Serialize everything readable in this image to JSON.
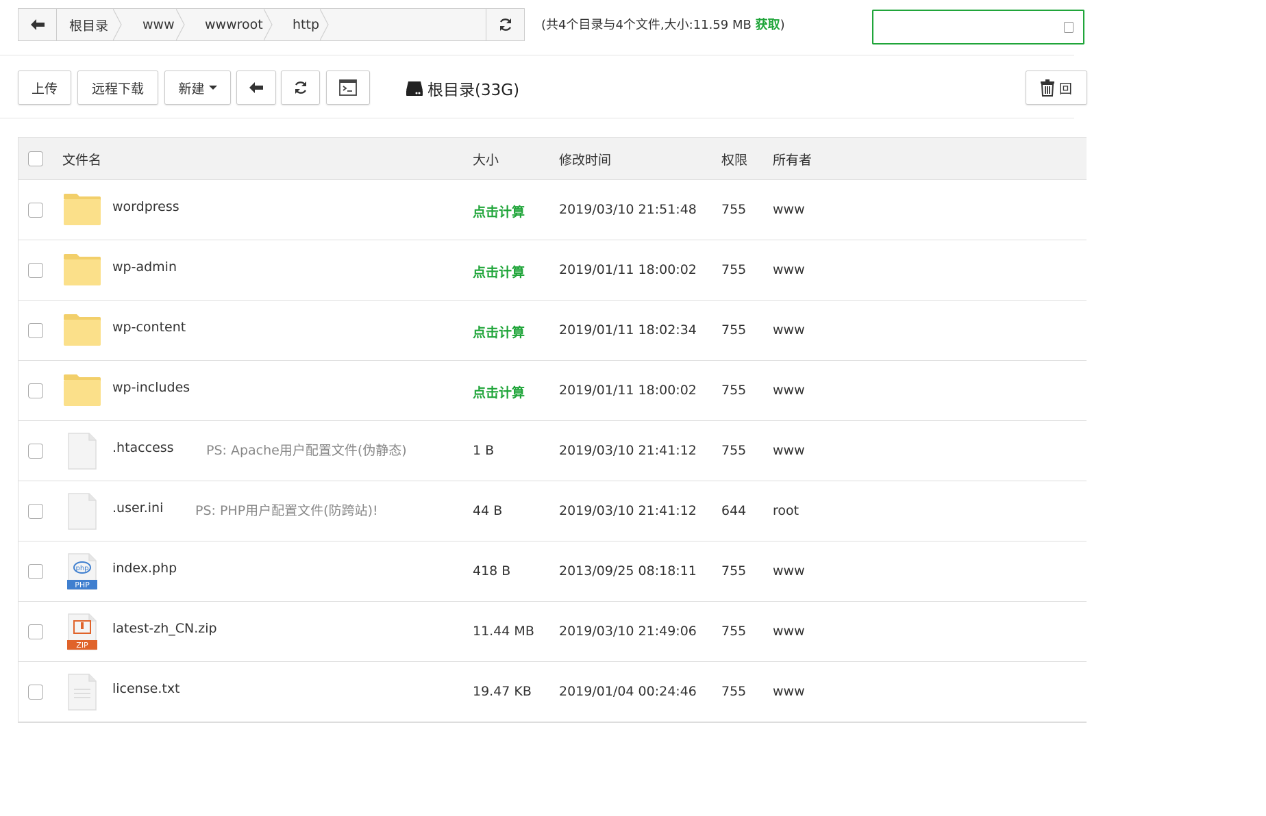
{
  "path": {
    "crumbs": [
      "根目录",
      "www",
      "wwwroot",
      "http"
    ],
    "summary_prefix": "(共4个目录与4个文件,大小:11.59 MB ",
    "summary_link": "获取",
    "summary_suffix": ")"
  },
  "toolbar": {
    "upload": "上传",
    "remote_download": "远程下载",
    "new": "新建",
    "disk_label": "根目录(33G)",
    "recycle_partial": "回"
  },
  "table": {
    "headers": {
      "name": "文件名",
      "size": "大小",
      "mtime": "修改时间",
      "perm": "权限",
      "owner": "所有者"
    },
    "rows": [
      {
        "name": "wordpress",
        "note": "",
        "size": "点击计算",
        "mtime": "2019/03/10 21:51:48",
        "perm": "755",
        "owner": "www",
        "type": "folder"
      },
      {
        "name": "wp-admin",
        "note": "",
        "size": "点击计算",
        "mtime": "2019/01/11 18:00:02",
        "perm": "755",
        "owner": "www",
        "type": "folder"
      },
      {
        "name": "wp-content",
        "note": "",
        "size": "点击计算",
        "mtime": "2019/01/11 18:02:34",
        "perm": "755",
        "owner": "www",
        "type": "folder"
      },
      {
        "name": "wp-includes",
        "note": "",
        "size": "点击计算",
        "mtime": "2019/01/11 18:00:02",
        "perm": "755",
        "owner": "www",
        "type": "folder"
      },
      {
        "name": ".htaccess",
        "note": "PS: Apache用户配置文件(伪静态)",
        "size": "1 B",
        "mtime": "2019/03/10 21:41:12",
        "perm": "755",
        "owner": "www",
        "type": "file"
      },
      {
        "name": ".user.ini",
        "note": "PS: PHP用户配置文件(防跨站)!",
        "size": "44 B",
        "mtime": "2019/03/10 21:41:12",
        "perm": "644",
        "owner": "root",
        "type": "file"
      },
      {
        "name": "index.php",
        "note": "",
        "size": "418 B",
        "mtime": "2013/09/25 08:18:11",
        "perm": "755",
        "owner": "www",
        "type": "php"
      },
      {
        "name": "latest-zh_CN.zip",
        "note": "",
        "size": "11.44 MB",
        "mtime": "2019/03/10 21:49:06",
        "perm": "755",
        "owner": "www",
        "type": "zip"
      },
      {
        "name": "license.txt",
        "note": "",
        "size": "19.47 KB",
        "mtime": "2019/01/04 00:24:46",
        "perm": "755",
        "owner": "www",
        "type": "txt"
      }
    ],
    "icon_labels": {
      "php": "PHP",
      "zip": "ZIP",
      "php_badge": "php"
    }
  },
  "colors": {
    "accent": "#20a53a",
    "folder": "#fbe08a",
    "php": "#3f7fcf",
    "zip": "#e0632a"
  }
}
